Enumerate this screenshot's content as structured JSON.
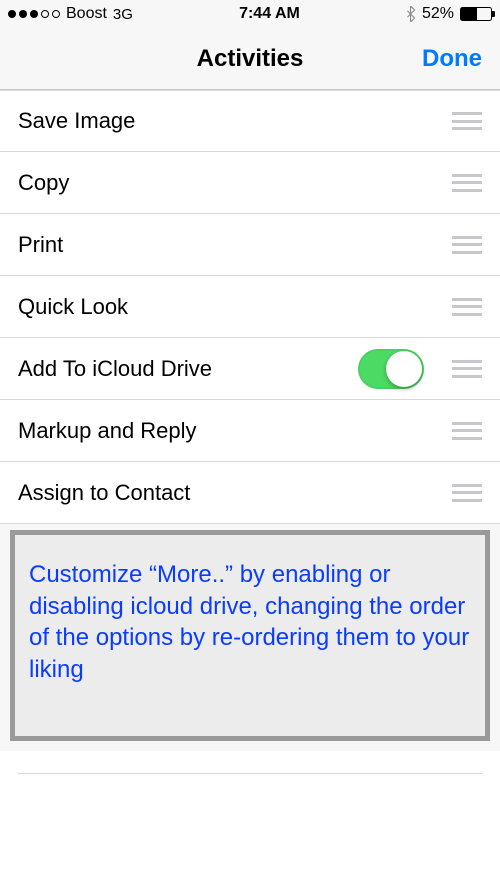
{
  "status": {
    "carrier": "Boost",
    "network": "3G",
    "time": "7:44 AM",
    "battery_pct": "52%",
    "battery_fill_pct": 52
  },
  "nav": {
    "title": "Activities",
    "done": "Done"
  },
  "rows": [
    {
      "label": "Save Image",
      "has_toggle": false
    },
    {
      "label": "Copy",
      "has_toggle": false
    },
    {
      "label": "Print",
      "has_toggle": false
    },
    {
      "label": "Quick Look",
      "has_toggle": false
    },
    {
      "label": "Add To iCloud Drive",
      "has_toggle": true,
      "toggle_on": true
    },
    {
      "label": "Markup and Reply",
      "has_toggle": false
    },
    {
      "label": "Assign to Contact",
      "has_toggle": false
    }
  ],
  "annotation": "Customize “More..” by enabling or disabling icloud drive, changing the order of the options by re-ordering them to your liking"
}
